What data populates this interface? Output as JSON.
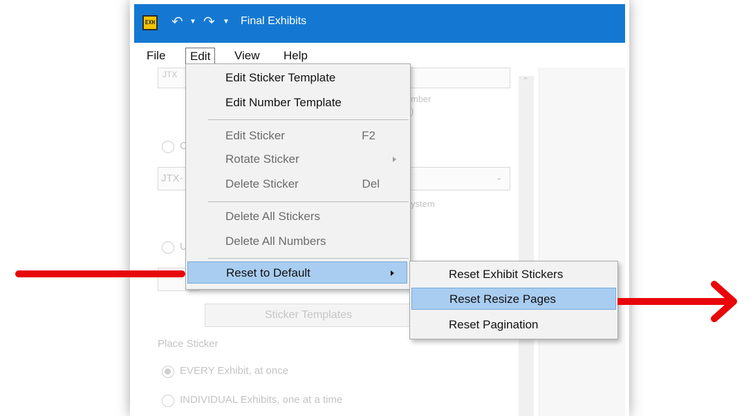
{
  "window": {
    "title": "Final Exhibits",
    "app_icon_text": "EXH"
  },
  "menubar": {
    "file": "File",
    "edit": "Edit",
    "view": "View",
    "help": "Help"
  },
  "background": {
    "field_prefix_1": "JTX",
    "field_prefix_2": "JTX-",
    "hint_1": "mber",
    "hint_1b": ")",
    "hint_2": "ystem",
    "radio_1_letter": "C",
    "radio_2_letter": "U",
    "sticker_templates_button": "Sticker Templates",
    "place_sticker_label": "Place Sticker",
    "option_every": "EVERY Exhibit, at once",
    "option_individual": "INDIVIDUAL Exhibits, one at a time"
  },
  "edit_menu": {
    "items": [
      {
        "label": "Edit Sticker Template",
        "enabled": true
      },
      {
        "label": "Edit Number Template",
        "enabled": true
      },
      {
        "label": "Edit Sticker",
        "shortcut": "F2",
        "enabled": false
      },
      {
        "label": "Rotate Sticker",
        "enabled": false,
        "submenu": true
      },
      {
        "label": "Delete Sticker",
        "shortcut": "Del",
        "enabled": false
      },
      {
        "label": "Delete All Stickers",
        "enabled": false
      },
      {
        "label": "Delete All Numbers",
        "enabled": false
      },
      {
        "label": "Reset to Default",
        "enabled": true,
        "submenu": true,
        "highlighted": true
      }
    ]
  },
  "reset_submenu": {
    "items": [
      {
        "label": "Reset Exhibit Stickers"
      },
      {
        "label": "Reset Resize Pages",
        "highlighted": true
      },
      {
        "label": "Reset Pagination"
      }
    ]
  },
  "colors": {
    "title_bar": "#1478d2",
    "highlight": "#a9cdf0",
    "annotation_arrow": "#e8070a"
  }
}
